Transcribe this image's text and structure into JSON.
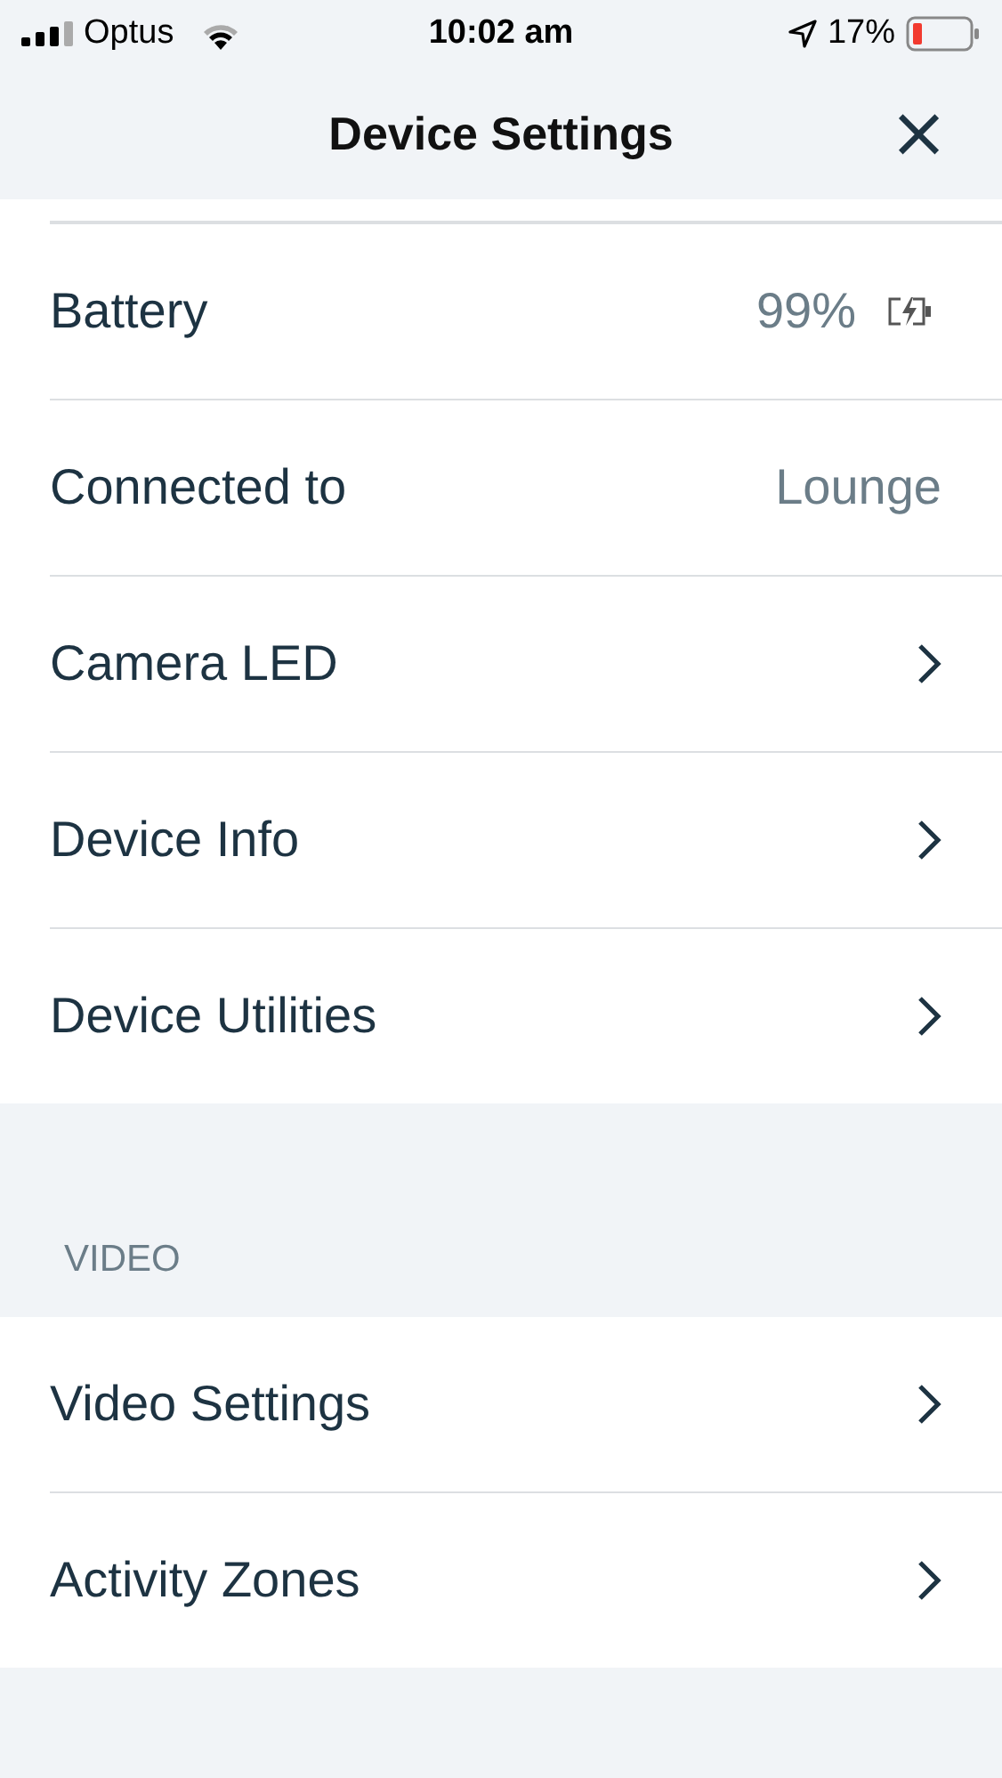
{
  "status_bar": {
    "carrier": "Optus",
    "time": "10:02 am",
    "battery": "17%"
  },
  "nav": {
    "title": "Device Settings",
    "close": "×"
  },
  "sections": [
    {
      "rows": [
        {
          "kind": "battery",
          "label": "Battery",
          "value": "99%"
        },
        {
          "kind": "value",
          "label": "Connected to",
          "value": "Lounge"
        },
        {
          "kind": "link",
          "label": "Camera LED"
        },
        {
          "kind": "link",
          "label": "Device Info"
        },
        {
          "kind": "link",
          "label": "Device Utilities"
        }
      ]
    },
    {
      "header": "VIDEO",
      "rows": [
        {
          "kind": "link",
          "label": "Video Settings"
        },
        {
          "kind": "link",
          "label": "Activity Zones"
        }
      ]
    }
  ]
}
